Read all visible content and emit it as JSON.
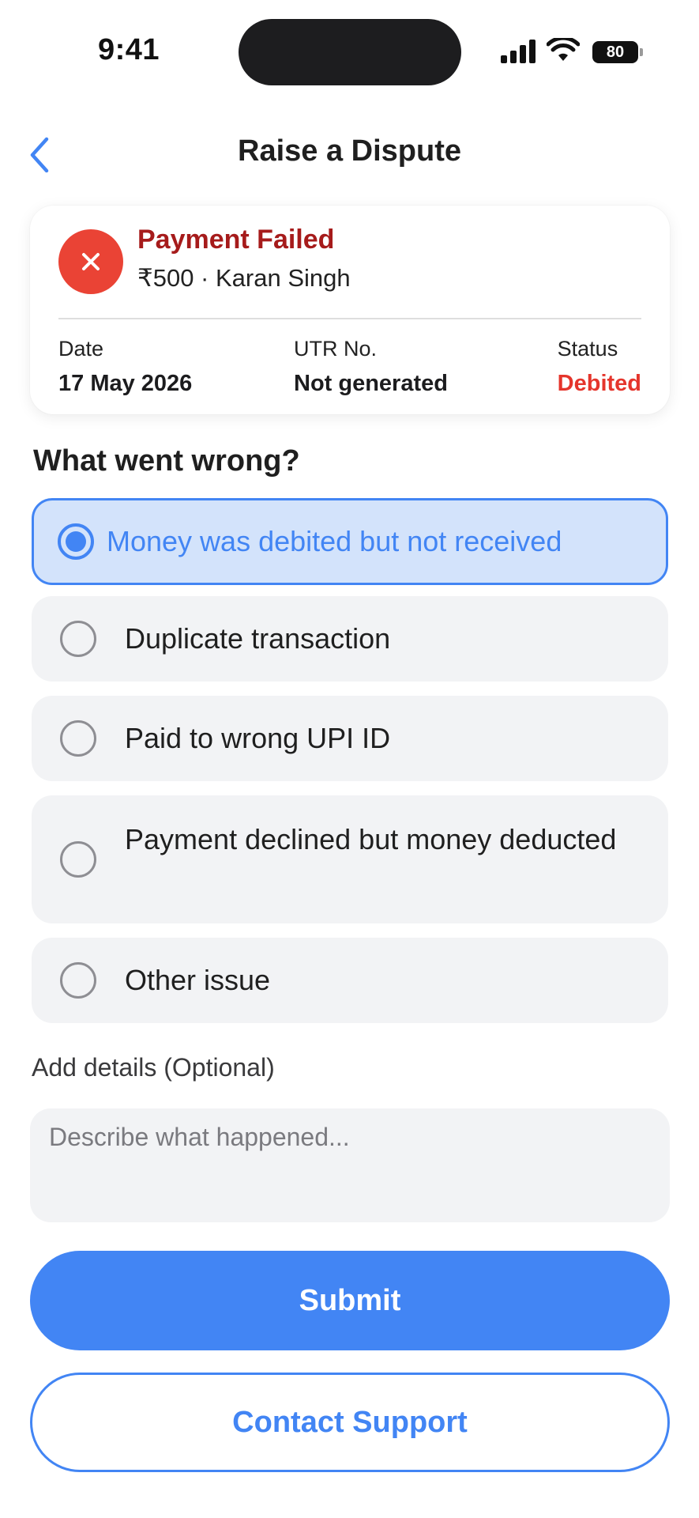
{
  "status_bar": {
    "time": "9:41",
    "battery": "80",
    "icons": [
      "signal-icon",
      "wifi-icon",
      "battery-icon"
    ]
  },
  "nav": {
    "title": "Raise a Dispute",
    "back_icon": "chevron-left-icon"
  },
  "transaction": {
    "title": "Payment Failed",
    "subtitle": "₹500 · Karan Singh",
    "icon": "close-icon",
    "date_label": "Date",
    "date_value": "17 May 2026",
    "utr_label": "UTR No.",
    "utr_value": "Not generated",
    "status_label": "Status",
    "status_value": "Debited"
  },
  "question": "What went wrong?",
  "options": [
    {
      "label": "Money was debited but not received",
      "selected": true
    },
    {
      "label": "Duplicate transaction",
      "selected": false
    },
    {
      "label": "Paid to wrong UPI ID",
      "selected": false
    },
    {
      "label": "Payment declined but money deducted",
      "selected": false
    },
    {
      "label": "Other issue",
      "selected": false
    }
  ],
  "details": {
    "label": "Add details (Optional)",
    "placeholder": "Describe what happened...",
    "value": ""
  },
  "buttons": {
    "submit": "Submit",
    "contact_support": "Contact Support"
  },
  "colors": {
    "accent": "#4285f4",
    "error": "#ea4335",
    "error_text": "#a61b1b",
    "status_debited": "#e5352c",
    "option_bg": "#f2f3f5",
    "option_selected_bg": "#d3e3fb"
  }
}
